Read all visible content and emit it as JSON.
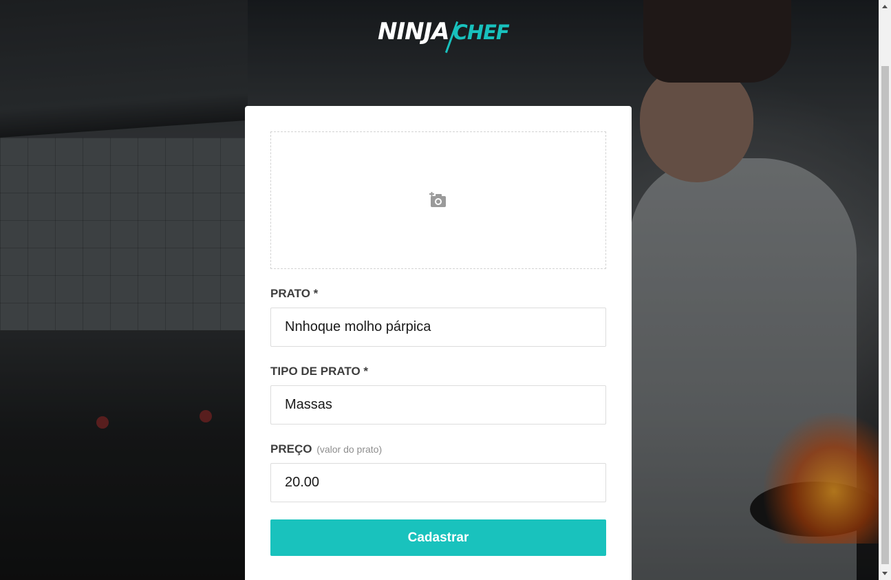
{
  "app": {
    "logo_primary": "NINJA",
    "logo_secondary": "CHEF"
  },
  "upload": {
    "icon": "add-photo-icon"
  },
  "form": {
    "dish_label": "PRATO *",
    "dish_value": "Nnhoque molho párpica",
    "type_label": "TIPO DE PRATO *",
    "type_value": "Massas",
    "price_label": "PREÇO",
    "price_hint": "(valor do prato)",
    "price_value": "20.00",
    "submit_label": "Cadastrar"
  },
  "colors": {
    "accent": "#19c2bd",
    "label": "#3e3e3e",
    "hint": "#8e8e8e"
  }
}
